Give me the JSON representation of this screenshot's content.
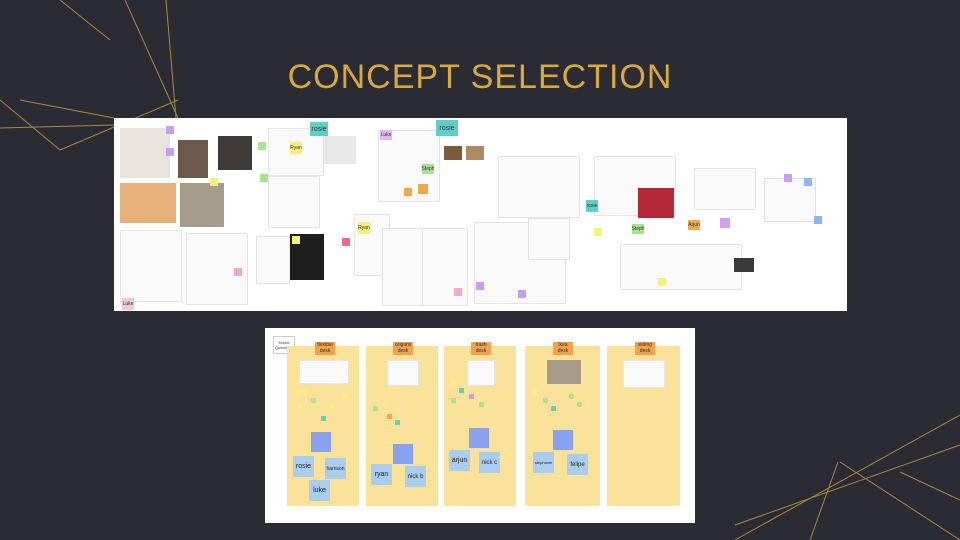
{
  "slide": {
    "title": "CONCEPT SELECTION",
    "colors": {
      "background": "#2a2b33",
      "accent": "#d9a93e"
    }
  },
  "top_board": {
    "names": {
      "rosie_a": "rosie",
      "ryan_a": "Ryan",
      "rosie_b": "rosie",
      "luke_a": "Luke",
      "ryan_b": "Ryan",
      "luke_b": "Luke",
      "steph_a": "Steph",
      "arjun": "Arjun",
      "rosie_c": "rosie",
      "steph_b": "Steph"
    }
  },
  "bottom_board": {
    "model_questions": "Model Questions",
    "columns": [
      {
        "label": "flexible desk",
        "names": [
          "rosie",
          "harrison",
          "luke"
        ]
      },
      {
        "label": "origami desk",
        "names": [
          "ryan",
          "nick b"
        ]
      },
      {
        "label": "trash desk",
        "names": [
          "arjun",
          "nick c"
        ]
      },
      {
        "label": "ikea desk",
        "names": [
          "stephanie",
          "felipe"
        ]
      },
      {
        "label": "sliding desk",
        "names": []
      }
    ]
  }
}
